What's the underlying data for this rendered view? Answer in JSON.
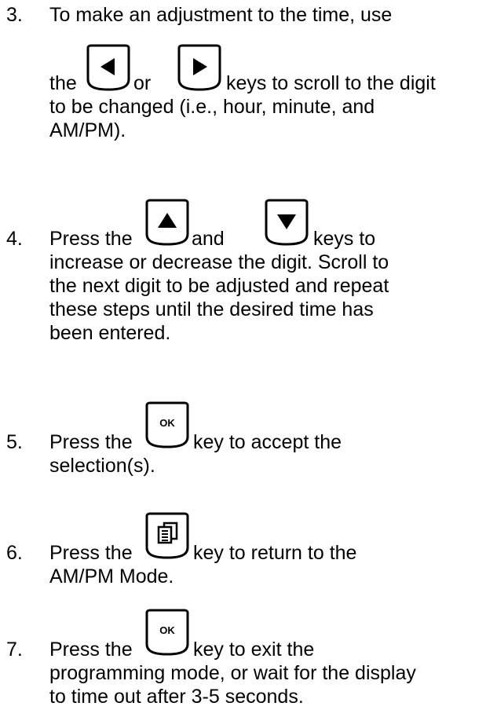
{
  "steps": [
    {
      "number": "3.",
      "lines": [
        "To make an adjustment to the time, use",
        "the",
        "or",
        "keys to scroll to the digit",
        "to be changed (i.e., hour, minute, and",
        "AM/PM)."
      ],
      "keys": [
        "left-arrow-key",
        "right-arrow-key"
      ]
    },
    {
      "number": "4.",
      "lines": [
        "Press the",
        "and",
        "keys to",
        "increase or decrease the digit. Scroll to",
        "the next digit to be adjusted and repeat",
        "these steps until the desired time has",
        "been entered."
      ],
      "keys": [
        "up-arrow-key",
        "down-arrow-key"
      ]
    },
    {
      "number": "5.",
      "lines": [
        "Press the",
        "key to accept the",
        "selection(s)."
      ],
      "keys": [
        "ok-key"
      ],
      "key_label": "OK"
    },
    {
      "number": "6.",
      "lines": [
        "Press the",
        "key to return to the",
        "AM/PM Mode."
      ],
      "keys": [
        "menu-pages-key"
      ]
    },
    {
      "number": "7.",
      "lines": [
        "Press the",
        "key to exit the",
        "programming mode, or wait for the display",
        "to time out after 3-5 seconds."
      ],
      "keys": [
        "ok-key"
      ],
      "key_label": "OK"
    }
  ]
}
